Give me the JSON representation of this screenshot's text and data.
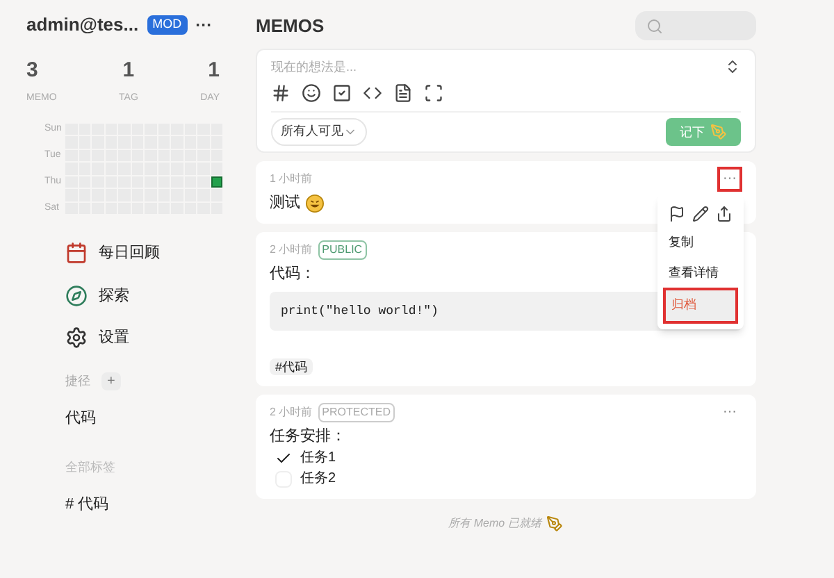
{
  "user": {
    "name": "admin@tes...",
    "badge": "MOD",
    "more": "···"
  },
  "stats": [
    {
      "value": "3",
      "label": "MEMO"
    },
    {
      "value": "1",
      "label": "TAG"
    },
    {
      "value": "1",
      "label": "DAY"
    }
  ],
  "heatmap": [
    {
      "label": "Sun",
      "cells": [
        false,
        false,
        false,
        false,
        false,
        false,
        false,
        false,
        false,
        false,
        false,
        false
      ]
    },
    {
      "cells": [
        false,
        false,
        false,
        false,
        false,
        false,
        false,
        false,
        false,
        false,
        false,
        false
      ]
    },
    {
      "label": "Tue",
      "cells": [
        false,
        false,
        false,
        false,
        false,
        false,
        false,
        false,
        false,
        false,
        false,
        false
      ]
    },
    {
      "cells": [
        false,
        false,
        false,
        false,
        false,
        false,
        false,
        false,
        false,
        false,
        false,
        false
      ]
    },
    {
      "label": "Thu",
      "cells": [
        false,
        false,
        false,
        false,
        false,
        false,
        false,
        false,
        false,
        false,
        false,
        true
      ]
    },
    {
      "cells": [
        false,
        false,
        false,
        false,
        false,
        false,
        false,
        false,
        false,
        false,
        false,
        false
      ]
    },
    {
      "label": "Sat",
      "cells": [
        false,
        false,
        false,
        false,
        false,
        false,
        false,
        false,
        false,
        false,
        false,
        false
      ]
    }
  ],
  "nav": [
    {
      "kind": "calendar",
      "label": "每日回顾"
    },
    {
      "kind": "explore",
      "label": "探索"
    },
    {
      "kind": "settings",
      "label": "设置"
    }
  ],
  "shortcuts": {
    "title": "捷径",
    "add": "+",
    "items": [
      "代码"
    ]
  },
  "tags": {
    "title": "全部标签",
    "items": [
      "# 代码"
    ]
  },
  "header": {
    "title": "MEMOS"
  },
  "editor": {
    "placeholder": "现在的想法是...",
    "visibility": "所有人可见",
    "submit": "记下"
  },
  "memos": [
    {
      "time": "1 小时前",
      "more": "···",
      "highlighted": true,
      "content": [
        {
          "kind": "text",
          "text": "测试",
          "emoji": true
        }
      ],
      "menu": {
        "items": [
          {
            "label": "复制",
            "highlighted": false,
            "danger": false
          },
          {
            "label": "查看详情",
            "highlighted": false,
            "danger": false
          },
          {
            "label": "归档",
            "highlighted": true,
            "danger": true
          }
        ]
      }
    },
    {
      "time": "2 小时前",
      "visibility": "PUBLIC",
      "content": [
        {
          "kind": "text",
          "text": "代码："
        },
        {
          "kind": "code",
          "text": "print(\"hello world!\")"
        },
        {
          "kind": "tag",
          "text": "#代码"
        }
      ]
    },
    {
      "time": "2 小时前",
      "visibility": "PROTECTED",
      "more": "···",
      "highlighted": false,
      "content": [
        {
          "kind": "text",
          "text": "任务安排："
        },
        {
          "kind": "task",
          "text": "任务1",
          "checked": true
        },
        {
          "kind": "task",
          "text": "任务2",
          "checked": false
        }
      ]
    }
  ],
  "footer": "所有 Memo 已就绪"
}
